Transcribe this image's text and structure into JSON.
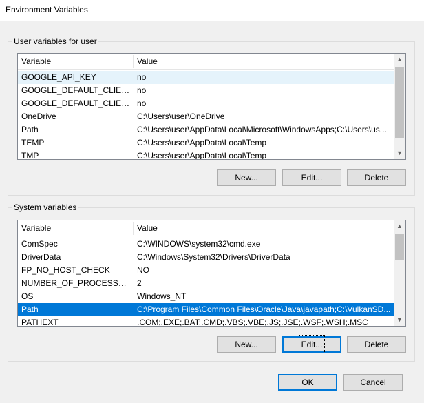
{
  "window": {
    "title": "Environment Variables"
  },
  "user_section": {
    "label": "User variables for user",
    "columns": {
      "variable": "Variable",
      "value": "Value"
    },
    "rows": [
      {
        "variable": "GOOGLE_API_KEY",
        "value": "no"
      },
      {
        "variable": "GOOGLE_DEFAULT_CLIENT_ID",
        "value": "no"
      },
      {
        "variable": "GOOGLE_DEFAULT_CLIENT_S...",
        "value": "no"
      },
      {
        "variable": "OneDrive",
        "value": "C:\\Users\\user\\OneDrive"
      },
      {
        "variable": "Path",
        "value": "C:\\Users\\user\\AppData\\Local\\Microsoft\\WindowsApps;C:\\Users\\us..."
      },
      {
        "variable": "TEMP",
        "value": "C:\\Users\\user\\AppData\\Local\\Temp"
      },
      {
        "variable": "TMP",
        "value": "C:\\Users\\user\\AppData\\Local\\Temp"
      }
    ],
    "buttons": {
      "new": "New...",
      "edit": "Edit...",
      "delete": "Delete"
    }
  },
  "system_section": {
    "label": "System variables",
    "columns": {
      "variable": "Variable",
      "value": "Value"
    },
    "rows": [
      {
        "variable": "ComSpec",
        "value": "C:\\WINDOWS\\system32\\cmd.exe"
      },
      {
        "variable": "DriverData",
        "value": "C:\\Windows\\System32\\Drivers\\DriverData"
      },
      {
        "variable": "FP_NO_HOST_CHECK",
        "value": "NO"
      },
      {
        "variable": "NUMBER_OF_PROCESSORS",
        "value": "2"
      },
      {
        "variable": "OS",
        "value": "Windows_NT"
      },
      {
        "variable": "Path",
        "value": "C:\\Program Files\\Common Files\\Oracle\\Java\\javapath;C:\\VulkanSD..."
      },
      {
        "variable": "PATHEXT",
        "value": ".COM;.EXE;.BAT;.CMD;.VBS;.VBE;.JS;.JSE;.WSF;.WSH;.MSC"
      }
    ],
    "selected_row": "Path",
    "buttons": {
      "new": "New...",
      "edit": "Edit...",
      "delete": "Delete"
    }
  },
  "footer": {
    "ok": "OK",
    "cancel": "Cancel"
  },
  "colors": {
    "selection": "#0078d7",
    "hover": "#e5f3fb",
    "button_face": "#e1e1e1"
  }
}
